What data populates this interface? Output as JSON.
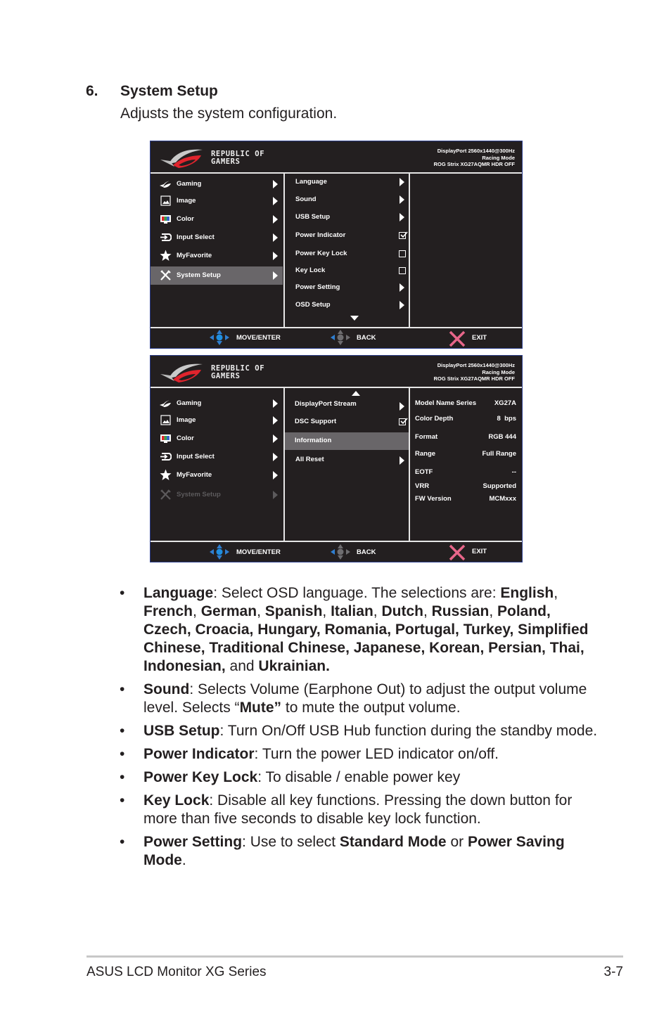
{
  "section": {
    "number": "6.",
    "title": "System Setup",
    "subtitle": "Adjusts the system configuration."
  },
  "osd_header": {
    "logo_line1": "REPUBLIC OF",
    "logo_line2": "GAMERS",
    "status_line1": "DisplayPort 2560x1440@300Hz",
    "status_line2": "Racing Mode",
    "status_line3": "ROG Strix XG27AQMR HDR OFF"
  },
  "main_menu": [
    {
      "label": "Gaming",
      "icon": "rog-eye-icon"
    },
    {
      "label": "Image",
      "icon": "image-icon"
    },
    {
      "label": "Color",
      "icon": "color-icon"
    },
    {
      "label": "Input Select",
      "icon": "input-select-icon"
    },
    {
      "label": "MyFavorite",
      "icon": "star-icon"
    },
    {
      "label": "System Setup",
      "icon": "wrench-screwdriver-icon"
    }
  ],
  "osd1": {
    "selected_main": "System Setup",
    "submenu": [
      {
        "label": "Language",
        "control": "arrow"
      },
      {
        "label": "Sound",
        "control": "arrow"
      },
      {
        "label": "USB Setup",
        "control": "arrow"
      },
      {
        "label": "Power Indicator",
        "control": "checkbox",
        "checked": true
      },
      {
        "label": "Power Key Lock",
        "control": "checkbox",
        "checked": false
      },
      {
        "label": "Key Lock",
        "control": "checkbox",
        "checked": false
      },
      {
        "label": "Power Setting",
        "control": "arrow"
      },
      {
        "label": "OSD Setup",
        "control": "arrow"
      }
    ]
  },
  "osd2": {
    "submenu": [
      {
        "label": "DisplayPort Stream",
        "control": "arrow"
      },
      {
        "label": "DSC Support",
        "control": "checkbox",
        "checked": true
      },
      {
        "label": "Information",
        "control": "none",
        "selected": true
      },
      {
        "label": "All Reset",
        "control": "arrow"
      }
    ],
    "info": [
      {
        "key": "Model Name Series",
        "value": "XG27A"
      },
      {
        "key": "Color Depth",
        "value": "8  bps"
      },
      {
        "key": "Format",
        "value": "RGB 444"
      },
      {
        "key": "Range",
        "value": "Full Range"
      },
      {
        "key": "EOTF",
        "value": "--"
      },
      {
        "key": "VRR",
        "value": "Supported"
      },
      {
        "key": "FW Version",
        "value": "MCMxxx"
      }
    ]
  },
  "osd_footer": {
    "move_enter": "MOVE/ENTER",
    "back": "BACK",
    "exit": "EXIT"
  },
  "colors": {
    "osd_bg": "#231f20",
    "osd_border": "#2c3e8c",
    "highlight": "#696669",
    "nav_blue": "#2f7fd1",
    "exit_pink": "#e8668a"
  },
  "bullets": [
    {
      "segments": [
        {
          "b": "Language"
        },
        {
          "t": ": Select OSD language. The selections are: "
        },
        {
          "b": "English"
        },
        {
          "t": ", "
        },
        {
          "b": "French"
        },
        {
          "t": ", "
        },
        {
          "b": "German"
        },
        {
          "t": ", "
        },
        {
          "b": "Spanish"
        },
        {
          "t": ", "
        },
        {
          "b": "Italian"
        },
        {
          "t": ", "
        },
        {
          "b": "Dutch"
        },
        {
          "t": ", "
        },
        {
          "b": "Russian"
        },
        {
          "t": ", "
        },
        {
          "b": "Poland, Czech, Croacia, Hungary, Romania, Portugal, Turkey, Simplified Chinese, Traditional Chinese, Japanese, Korean, Persian, Thai, Indonesian,"
        },
        {
          "t": " and "
        },
        {
          "b": "Ukrainian."
        }
      ]
    },
    {
      "segments": [
        {
          "b": "Sound"
        },
        {
          "t": ": Selects Volume (Earphone Out) to adjust the output volume level. Selects “"
        },
        {
          "b": "Mute”"
        },
        {
          "t": " to mute the output volume."
        }
      ]
    },
    {
      "segments": [
        {
          "b": "USB Setup"
        },
        {
          "t": ": Turn On/Off USB Hub function during the standby mode."
        }
      ]
    },
    {
      "segments": [
        {
          "b": "Power Indicator"
        },
        {
          "t": ": Turn the power LED indicator on/off."
        }
      ]
    },
    {
      "segments": [
        {
          "b": "Power Key Lock"
        },
        {
          "t": ": To disable / enable power key"
        }
      ]
    },
    {
      "segments": [
        {
          "b": "Key Lock"
        },
        {
          "t": ": Disable all key functions. Pressing the down button for more than five seconds to disable key lock function."
        }
      ]
    },
    {
      "segments": [
        {
          "b": "Power Setting"
        },
        {
          "t": ": Use to select "
        },
        {
          "b": "Standard Mode"
        },
        {
          "t": " or "
        },
        {
          "b": "Power Saving Mode"
        },
        {
          "t": "."
        }
      ]
    }
  ],
  "bullet_glyph": "•",
  "page_footer": {
    "left": "ASUS LCD Monitor XG Series",
    "right": "3-7"
  }
}
